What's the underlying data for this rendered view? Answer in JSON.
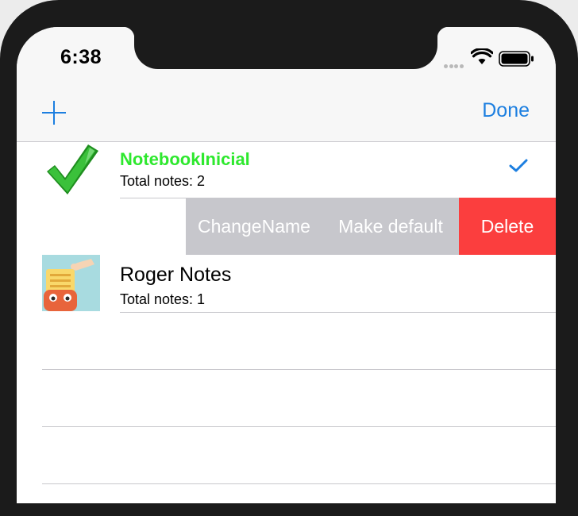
{
  "status_bar": {
    "time": "6:38"
  },
  "nav": {
    "add_icon": "plus-icon",
    "done_label": "Done",
    "accent_color": "#1d7fe0"
  },
  "notebooks": [
    {
      "title": "NotebookInicial",
      "subtitle": "Total notes: 2",
      "title_color": "#2ee82e",
      "thumbnail_icon": "green-checkmark-icon",
      "selected": true
    },
    {
      "title": "Roger Notes",
      "subtitle": "Total notes: 1",
      "thumbnail_icon": "notes-robot-thumbnail",
      "selected": false
    }
  ],
  "swipe_actions": {
    "change_name": "ChangeName",
    "make_default": "Make default",
    "delete": "Delete",
    "delete_color": "#fb3e3e",
    "neutral_color": "#c7c7cc"
  }
}
